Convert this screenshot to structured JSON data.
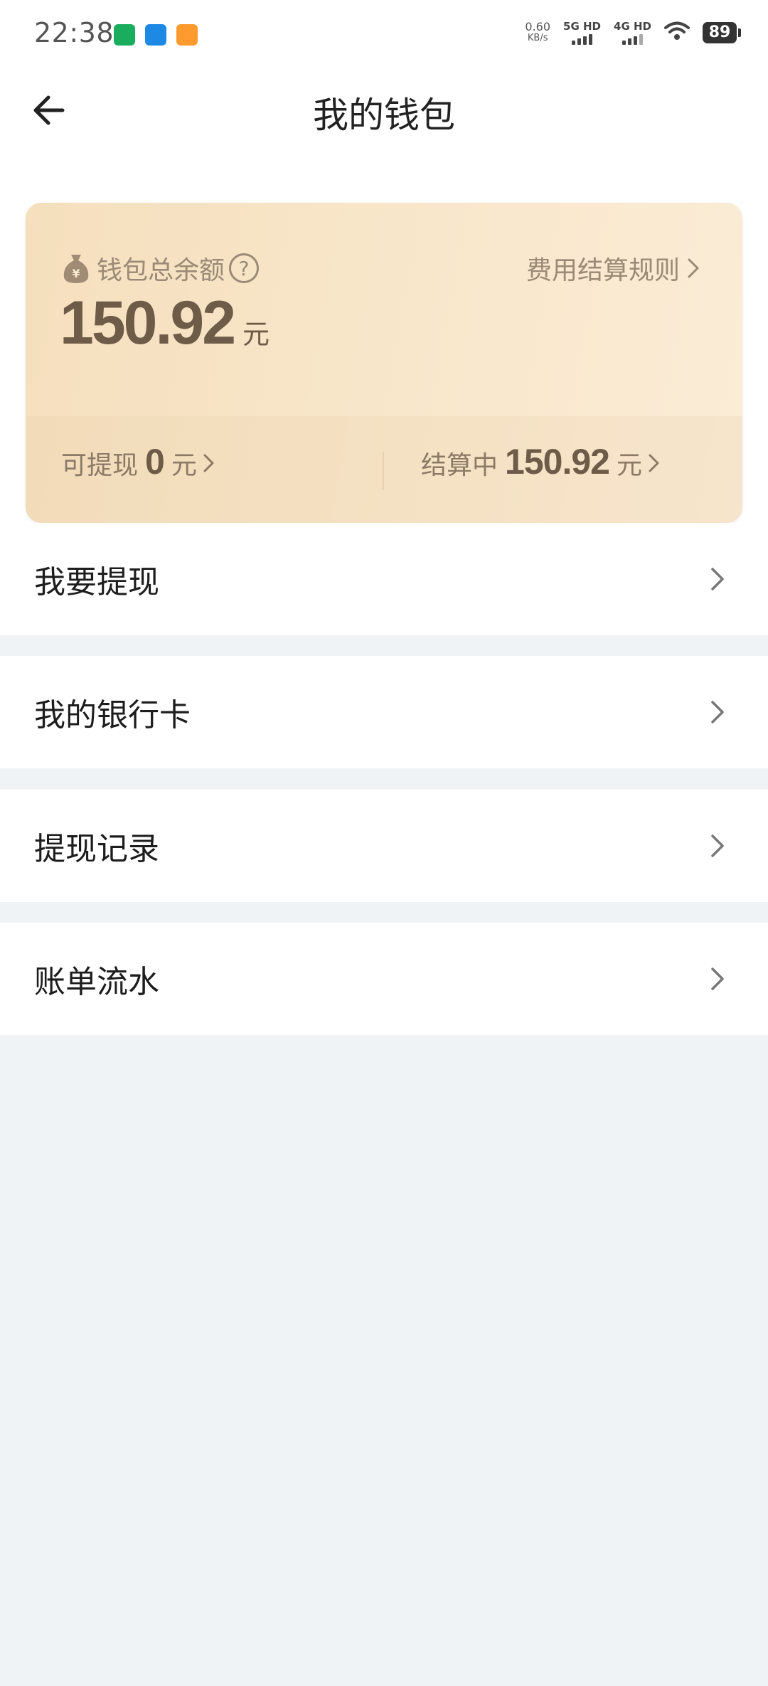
{
  "status": {
    "time": "22:38",
    "net_speed_value": "0.60",
    "net_speed_unit": "KB/s",
    "sim1": "5G HD",
    "sim2": "4G HD",
    "battery": "89"
  },
  "header": {
    "title": "我的钱包"
  },
  "wallet": {
    "balance_label": "钱包总余额",
    "help_symbol": "?",
    "rules_label": "费用结算规则",
    "balance_value": "150.92",
    "balance_unit": "元",
    "withdrawable_label": "可提现",
    "withdrawable_value": "0",
    "withdrawable_unit": "元",
    "settling_label": "结算中",
    "settling_value": "150.92",
    "settling_unit": "元"
  },
  "menu": [
    {
      "label": "我要提现"
    },
    {
      "label": "我的银行卡"
    },
    {
      "label": "提现记录"
    },
    {
      "label": "账单流水"
    }
  ],
  "colors": {
    "card_start": "#f5dfbd",
    "card_end": "#fbecd6",
    "amount_text": "#6e5b48",
    "muted_text": "#9a8a76",
    "page_bg": "#f0f3f6"
  }
}
